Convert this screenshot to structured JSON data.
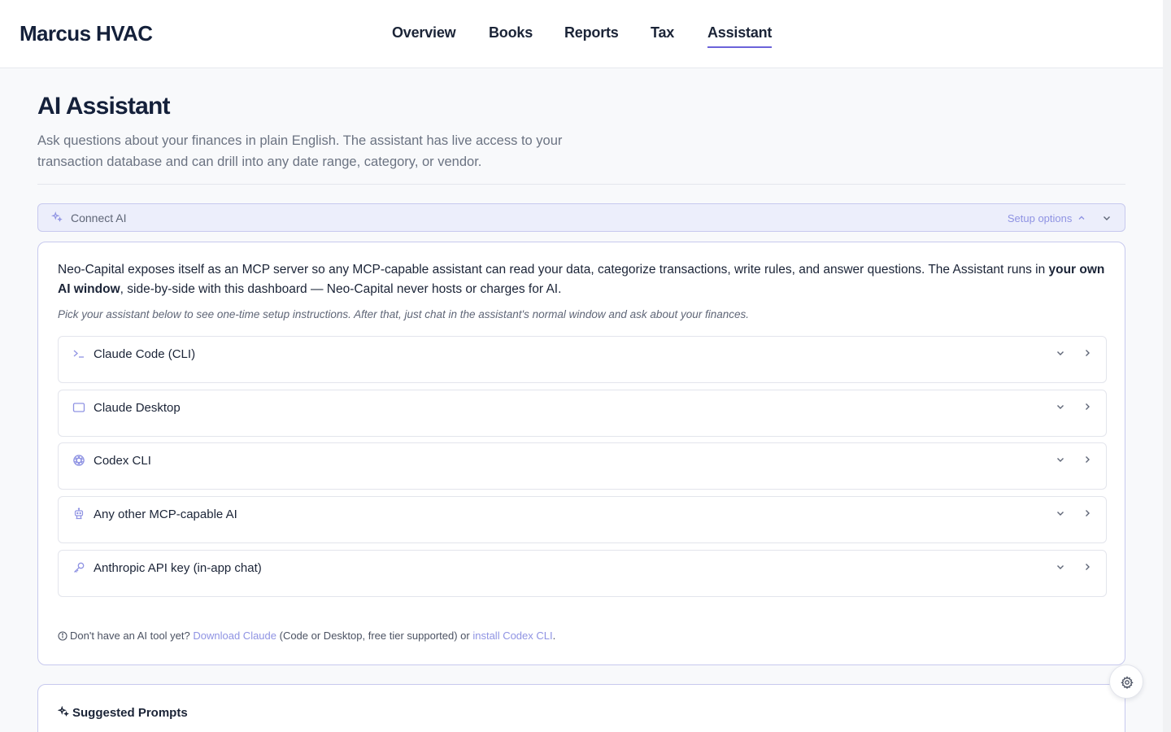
{
  "brand": "Marcus HVAC",
  "nav": {
    "overview": "Overview",
    "books": "Books",
    "reports": "Reports",
    "tax": "Tax",
    "assistant": "Assistant"
  },
  "page": {
    "title": "AI Assistant",
    "description": "Ask questions about your finances in plain English. The assistant has live access to your transaction database and can drill into any date range, category, or vendor."
  },
  "connect": {
    "label": "Connect AI",
    "setup_options": "Setup options"
  },
  "panel": {
    "intro_part1": "Neo-Capital exposes itself as an MCP server so any MCP-capable assistant can read your data, categorize transactions, write rules, and answer questions. The Assistant runs in ",
    "intro_bold": "your own AI window",
    "intro_part2": ", side-by-side with this dashboard — Neo-Capital never hosts or charges for AI.",
    "hint": "Pick your assistant below to see one-time setup instructions. After that, just chat in the assistant's normal window and ask about your finances.",
    "options": [
      {
        "label": "Claude Code (CLI)",
        "icon": "terminal-icon"
      },
      {
        "label": "Claude Desktop",
        "icon": "window-icon"
      },
      {
        "label": "Codex CLI",
        "icon": "openai-icon"
      },
      {
        "label": "Any other MCP-capable AI",
        "icon": "robot-icon"
      },
      {
        "label": "Anthropic API key (in-app chat)",
        "icon": "key-icon"
      }
    ],
    "footnote": {
      "prefix": "Don't have an AI tool yet? ",
      "link1": "Download Claude",
      "middle": " (Code or Desktop, free tier supported) or ",
      "link2": "install Codex CLI",
      "suffix": "."
    }
  },
  "prompts": {
    "title": "Suggested Prompts"
  },
  "colors": {
    "accent": "#6b63d9",
    "link": "#8f93e3",
    "border_accent": "#c7c9ee",
    "bar_bg": "#eceefb"
  }
}
